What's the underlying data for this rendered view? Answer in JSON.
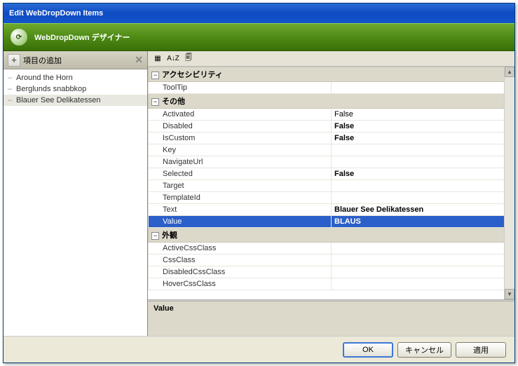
{
  "title": "Edit WebDropDown Items",
  "designer_label": "WebDropDown デザイナー",
  "add_item_label": "項目の追加",
  "tree_items": [
    {
      "label": "Around the Horn",
      "selected": false
    },
    {
      "label": "Berglunds snabbkop",
      "selected": false
    },
    {
      "label": "Blauer See Delikatessen",
      "selected": true
    }
  ],
  "toolbar": {
    "cat": "▦",
    "az": "A↓Z",
    "prop": "🗐"
  },
  "categories": [
    {
      "name": "アクセシビリティ",
      "props": [
        {
          "name": "ToolTip",
          "value": "",
          "bold": false
        }
      ]
    },
    {
      "name": "その他",
      "props": [
        {
          "name": "Activated",
          "value": "False",
          "bold": false
        },
        {
          "name": "Disabled",
          "value": "False",
          "bold": true
        },
        {
          "name": "IsCustom",
          "value": "False",
          "bold": true
        },
        {
          "name": "Key",
          "value": "",
          "bold": false
        },
        {
          "name": "NavigateUrl",
          "value": "",
          "bold": false
        },
        {
          "name": "Selected",
          "value": "False",
          "bold": true
        },
        {
          "name": "Target",
          "value": "",
          "bold": false
        },
        {
          "name": "TemplateId",
          "value": "",
          "bold": false
        },
        {
          "name": "Text",
          "value": "Blauer See Delikatessen",
          "bold": true
        },
        {
          "name": "Value",
          "value": "BLAUS",
          "bold": true,
          "selected": true
        }
      ]
    },
    {
      "name": "外観",
      "props": [
        {
          "name": "ActiveCssClass",
          "value": "",
          "bold": false
        },
        {
          "name": "CssClass",
          "value": "",
          "bold": false
        },
        {
          "name": "DisabledCssClass",
          "value": "",
          "bold": false
        },
        {
          "name": "HoverCssClass",
          "value": "",
          "bold": false
        }
      ]
    }
  ],
  "desc_title": "Value",
  "buttons": {
    "ok": "OK",
    "cancel": "キャンセル",
    "apply": "適用"
  }
}
